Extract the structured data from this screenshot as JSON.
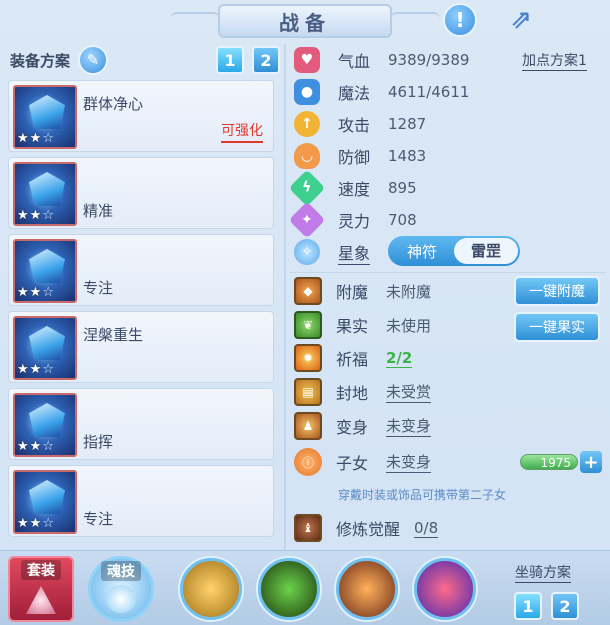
{
  "title": "战备",
  "header": {
    "scheme_label": "装备方案",
    "scheme_tabs": [
      "1",
      "2"
    ]
  },
  "plans": [
    {
      "name": "群体净心",
      "enhance": "可强化",
      "stars": 2
    },
    {
      "name": "精准",
      "stars": 2
    },
    {
      "name": "专注",
      "stars": 2
    },
    {
      "name": "涅槃重生",
      "stars": 2
    },
    {
      "name": "指挥",
      "stars": 2
    },
    {
      "name": "专注",
      "stars": 2
    }
  ],
  "stats": [
    {
      "label": "气血",
      "value": "9389/9389",
      "color": "#e35b7c"
    },
    {
      "label": "魔法",
      "value": "4611/4611",
      "color": "#3f8fe0"
    },
    {
      "label": "攻击",
      "value": "1287",
      "color": "#f2b434"
    },
    {
      "label": "防御",
      "value": "1483",
      "color": "#f29a4a"
    },
    {
      "label": "速度",
      "value": "895",
      "color": "#3fcf8f"
    },
    {
      "label": "灵力",
      "value": "708",
      "color": "#c07be8"
    }
  ],
  "point_plan": "加点方案1",
  "star_label": "星象",
  "star_toggle": [
    "神符",
    "雷罡"
  ],
  "status": [
    {
      "label": "附魔",
      "value": "未附魔"
    },
    {
      "label": "果实",
      "value": "未使用"
    },
    {
      "label": "祈福",
      "value": "2/2"
    },
    {
      "label": "封地",
      "value": "未受赏"
    },
    {
      "label": "变身",
      "value": "未变身"
    },
    {
      "label": "子女",
      "value": "未变身"
    }
  ],
  "buttons": {
    "enchant": "一键附魔",
    "fruit": "一键果实"
  },
  "counter_value": "1975",
  "hint": "穿戴时装或饰品可携带第二子女",
  "cultivation": {
    "label": "修炼觉醒",
    "value": "0/8"
  },
  "bottom": {
    "tab1": "套装",
    "tab2": "魂技",
    "mount_label": "坐骑方案",
    "mount_tabs": [
      "1",
      "2"
    ]
  },
  "star_symbols": {
    "on": "★",
    "off": "☆"
  }
}
